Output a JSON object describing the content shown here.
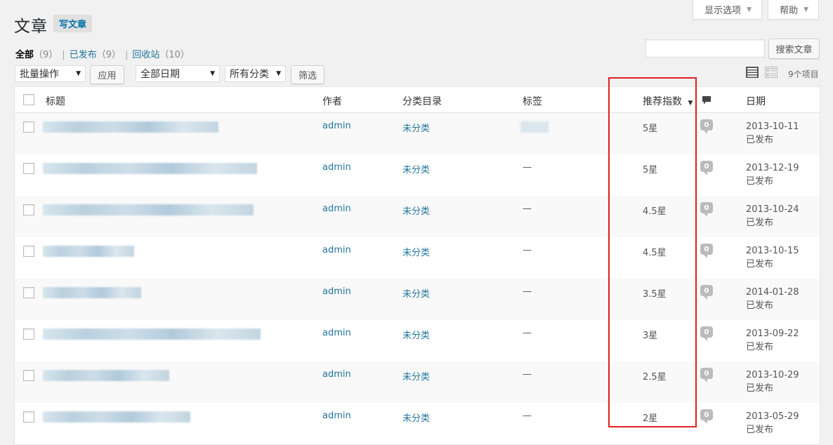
{
  "screen_tabs": [
    {
      "label": "显示选项"
    },
    {
      "label": "帮助"
    }
  ],
  "header": {
    "title": "文章",
    "add_new": "写文章"
  },
  "filters": {
    "all": {
      "label": "全部",
      "count": "（9）"
    },
    "published": {
      "label": "已发布",
      "count": "（9）"
    },
    "trash": {
      "label": "回收站",
      "count": "（10）"
    }
  },
  "search": {
    "value": "",
    "button": "搜索文章"
  },
  "toolbar": {
    "bulk_action": "批量操作",
    "apply": "应用",
    "date_filter": "全部日期",
    "category_filter": "所有分类",
    "filter_button": "筛选",
    "items_count": "9个项目"
  },
  "columns": {
    "title": "标题",
    "author": "作者",
    "categories": "分类目录",
    "tags": "标签",
    "rating": "推荐指数",
    "date": "日期"
  },
  "rows": [
    {
      "author": "admin",
      "category": "未分类",
      "tag": "",
      "rating": "5星",
      "comments": "0",
      "date": "2013-10-11",
      "status": "已发布"
    },
    {
      "author": "admin",
      "category": "未分类",
      "tag": "—",
      "rating": "5星",
      "comments": "0",
      "date": "2013-12-19",
      "status": "已发布"
    },
    {
      "author": "admin",
      "category": "未分类",
      "tag": "—",
      "rating": "4.5星",
      "comments": "0",
      "date": "2013-10-24",
      "status": "已发布"
    },
    {
      "author": "admin",
      "category": "未分类",
      "tag": "—",
      "rating": "4.5星",
      "comments": "0",
      "date": "2013-10-15",
      "status": "已发布"
    },
    {
      "author": "admin",
      "category": "未分类",
      "tag": "—",
      "rating": "3.5星",
      "comments": "0",
      "date": "2014-01-28",
      "status": "已发布"
    },
    {
      "author": "admin",
      "category": "未分类",
      "tag": "—",
      "rating": "3星",
      "comments": "0",
      "date": "2013-09-22",
      "status": "已发布"
    },
    {
      "author": "admin",
      "category": "未分类",
      "tag": "—",
      "rating": "2.5星",
      "comments": "0",
      "date": "2013-10-29",
      "status": "已发布"
    },
    {
      "author": "admin",
      "category": "未分类",
      "tag": "—",
      "rating": "2星",
      "comments": "0",
      "date": "2013-05-29",
      "status": "已发布"
    }
  ],
  "colors": {
    "link": "#21759b",
    "highlight_box": "#e02020"
  }
}
